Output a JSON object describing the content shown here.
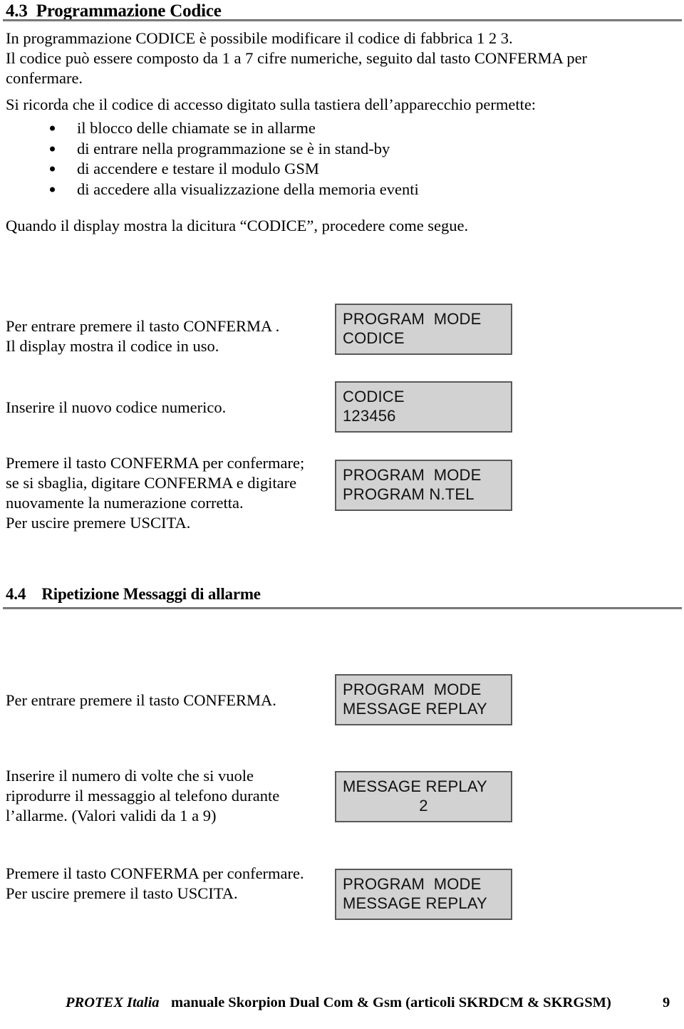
{
  "document": {
    "sections": [
      {
        "number": "4.3",
        "title": "Programmazione Codice"
      },
      {
        "number": "4.4",
        "title": "Ripetizione Messaggi di allarme"
      }
    ],
    "intro": {
      "line1": "In  programmazione CODICE è possibile modificare il codice di fabbrica 1 2 3.",
      "line2": " Il codice può essere composto da 1 a 7 cifre numeriche, seguito dal tasto CONFERMA  per",
      "line3": "confermare.",
      "line4": "Si ricorda che il codice di accesso digitato sulla tastiera dell’apparecchio permette:"
    },
    "bullets": [
      "il blocco delle chiamate se in allarme",
      "di entrare nella programmazione se è in stand-by",
      "di accendere e testare il modulo GSM",
      "di accedere alla visualizzazione della memoria eventi"
    ],
    "after_bullets": "Quando il display mostra la dicitura “CODICE”, procedere come segue.",
    "steps": [
      {
        "text_lines": [
          "Per entrare premere il tasto CONFERMA .",
          "Il display mostra il codice in uso."
        ],
        "lcd": {
          "line1": "PROGRAM  MODE",
          "line2": "CODICE",
          "line2_align": "left"
        }
      },
      {
        "text_lines": [
          "Inserire il nuovo codice numerico."
        ],
        "lcd": {
          "line1": "CODICE",
          "line2": "123456",
          "line2_align": "left"
        }
      },
      {
        "text_lines": [
          "Premere il tasto CONFERMA  per confermare;",
          "se si sbaglia, digitare CONFERMA e digitare",
          "nuovamente la numerazione corretta.",
          "Per uscire premere USCITA."
        ],
        "lcd": {
          "line1": "PROGRAM  MODE",
          "line2": "PROGRAM N.TEL",
          "line2_align": "left"
        }
      },
      {
        "text_lines": [
          "Per entrare premere il tasto CONFERMA."
        ],
        "lcd": {
          "line1": "PROGRAM  MODE",
          "line2": "MESSAGE REPLAY",
          "line2_align": "left"
        }
      },
      {
        "text_lines": [
          "Inserire il numero di volte che si vuole",
          "riprodurre il messaggio al telefono durante",
          "l’allarme. (Valori validi da 1 a 9)"
        ],
        "lcd": {
          "line1": "MESSAGE REPLAY",
          "line2": "2",
          "line2_align": "center"
        }
      },
      {
        "text_lines": [
          "Premere il tasto CONFERMA per confermare.",
          "Per uscire premere il tasto USCITA."
        ],
        "lcd": {
          "line1": "PROGRAM  MODE",
          "line2": "MESSAGE REPLAY",
          "line2_align": "left"
        }
      }
    ],
    "footer": {
      "brand": "PROTEX Italia",
      "text": "manuale Skorpion Dual Com  & Gsm (articoli SKRDCM & SKRGSM)",
      "page_number": "9"
    },
    "colors": {
      "lcd_background": "#d2d2d2",
      "lcd_border": "#595959",
      "rule": "#7d7d7d",
      "text": "#000000"
    }
  }
}
